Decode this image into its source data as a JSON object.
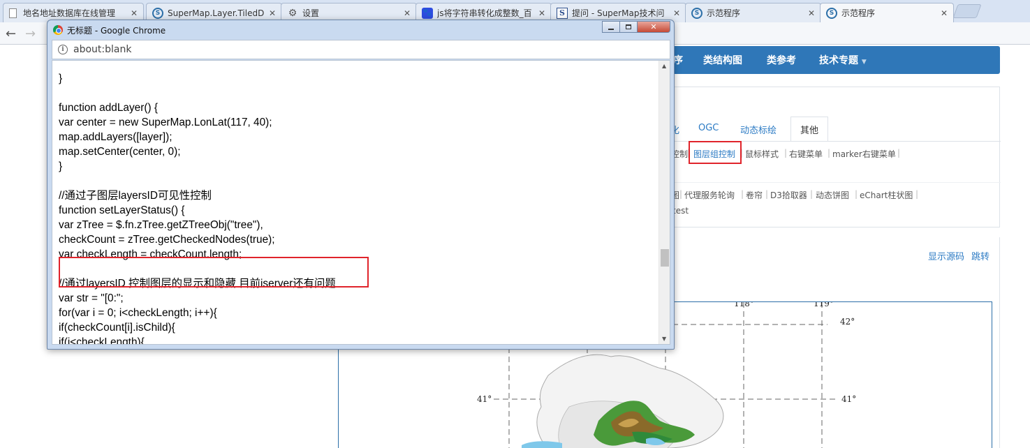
{
  "tabs": [
    {
      "label": "地名地址数据库在线管理",
      "icon": "doc-icon"
    },
    {
      "label": "SuperMap.Layer.TiledD",
      "icon": "supermap-icon"
    },
    {
      "label": "设置",
      "icon": "gear-icon"
    },
    {
      "label": "js将字符串转化成整数_百",
      "icon": "baidu-paw-icon"
    },
    {
      "label": "提问 - SuperMap技术问",
      "icon": "s-icon"
    },
    {
      "label": "示范程序",
      "icon": "supermap-icon"
    },
    {
      "label": "示范程序",
      "icon": "supermap-icon"
    }
  ],
  "popup": {
    "title": "无标题 - Google Chrome",
    "address": "about:blank",
    "code_lines": [
      "    ",
      "}",
      "",
      "function addLayer() {",
      "var center = new SuperMap.LonLat(117, 40);",
      "map.addLayers([layer]);",
      "map.setCenter(center, 0);",
      "}",
      "",
      "//通过子图层layersID可见性控制",
      "function setLayerStatus() {",
      "var zTree = $.fn.zTree.getZTreeObj(\"tree\"),",
      "checkCount = zTree.getCheckedNodes(true);",
      "var checkLength = checkCount.length;",
      "",
      "//通过layersID 控制图层的显示和隐藏 目前iserver还有问题",
      "var str = \"[0:\";",
      "for(var i = 0; i<checkLength; i++){",
      "if(checkCount[i].isChild){",
      "if(i<checkLength){",
      ""
    ]
  },
  "page": {
    "nav": [
      "序",
      "类结构图",
      "类参考",
      "技术专题"
    ],
    "tabs": [
      "化",
      "OGC",
      "动态标绘",
      "其他"
    ],
    "links_row1": [
      "控制",
      "图层组控制",
      "鼠标样式",
      "右键菜单",
      "marker右键菜单"
    ],
    "links_row2": [
      "图",
      "代理服务轮询",
      "卷帘",
      "D3拾取器",
      "动态饼图",
      "eChart柱状图"
    ],
    "links_row3": [
      "test"
    ],
    "show_source": "显示源码",
    "jump": "跳转",
    "map_labels": {
      "lon_118": "118°",
      "lon_119": "119°",
      "lat_42": "42°",
      "lat_41_left": "41°",
      "lat_41_right": "41°"
    }
  },
  "colors": {
    "accent_blue": "#2f77b8",
    "link_blue": "#2c7bc4",
    "highlight_red": "#e0242b"
  }
}
